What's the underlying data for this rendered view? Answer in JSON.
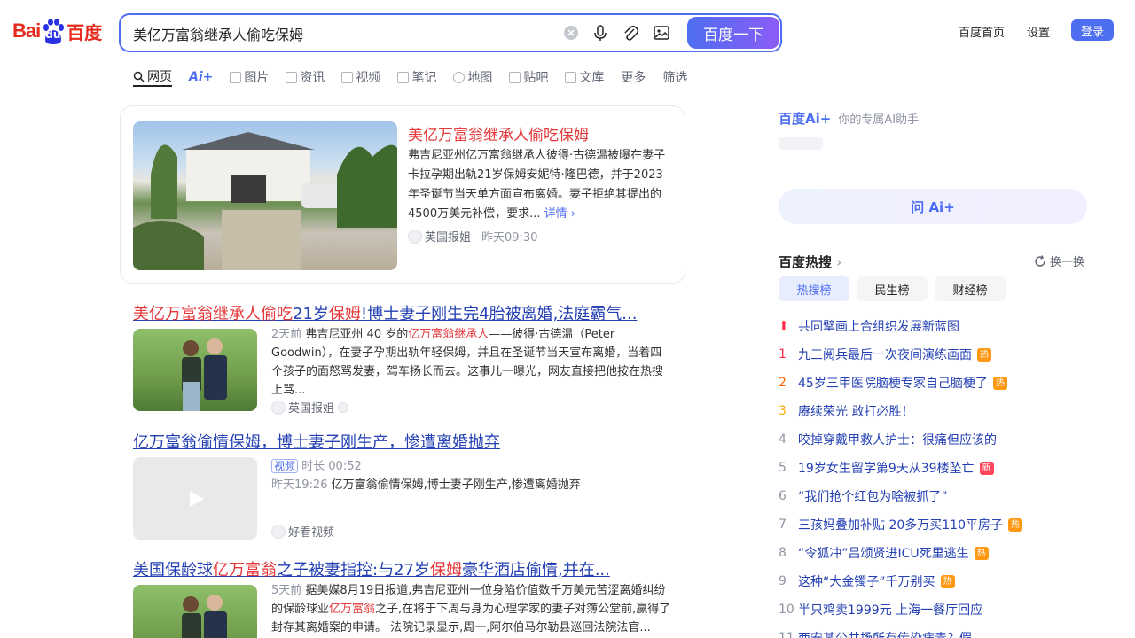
{
  "logo": {
    "left": "Bai",
    "paw": "du",
    "right": "百度"
  },
  "search": {
    "query": "美亿万富翁继承人偷吃保姆",
    "button": "百度一下"
  },
  "top_links": {
    "home": "百度首页",
    "settings": "设置",
    "login": "登录"
  },
  "tabs": [
    "网页",
    "Ai+",
    "图片",
    "资讯",
    "视频",
    "笔记",
    "地图",
    "贴吧",
    "文库",
    "更多",
    "筛选"
  ],
  "card": {
    "title": "美亿万富翁继承人偷吃保姆",
    "desc": "弗吉尼亚州亿万富翁继承人彼得·古德温被曝在妻子卡拉孕期出轨21岁保姆安妮特·隆巴德，并于2023年圣诞节当天单方面宣布离婚。妻子拒绝其提出的4500万美元补偿，要求...",
    "more": "详情 ›",
    "source": "英国报姐",
    "time": "昨天09:30"
  },
  "results": [
    {
      "title_parts": [
        [
          "美亿万富翁继承人偷吃",
          true
        ],
        [
          "21岁",
          false
        ],
        [
          "保姆",
          true
        ],
        [
          "!博士妻子刚生完4胎被离婚,法庭霸气...",
          false
        ]
      ],
      "time": "2天前",
      "desc_a": "弗吉尼亚州 40 岁的",
      "desc_hl": "亿万富翁继承人",
      "desc_b": "——彼得·古德温（Peter Goodwin），在妻子孕期出轨年轻保姆，并且在圣诞节当天宣布离婚，当着四个孩子的面怒骂发妻，驾车扬长而去。这事儿一曝光，网友直接把他按在热搜上骂...",
      "source": "英国报姐"
    },
    {
      "title": "亿万富翁偷情保姆，博士妻子刚生产，惨遭离婚抛弃",
      "tag": "视频",
      "duration": "时长 00:52",
      "time": "昨天19:26",
      "desc": "亿万富翁偷情保姆,博士妻子刚生产,惨遭离婚抛弃",
      "source": "好看视频"
    },
    {
      "title_a": "美国保龄球",
      "title_hl1": "亿万富翁",
      "title_b": "之子被妻指控:与27岁",
      "title_hl2": "保姆",
      "title_c": "豪华酒店偷情,并在...",
      "time": "5天前",
      "desc_a": "据美媒8月19日报道,弗吉尼亚州一位身陷价值数千万美元苦涩离婚纠纷的保龄球业",
      "desc_hl": "亿万富翁",
      "desc_b": "之子,在将于下周与身为心理学家的妻子对簿公堂前,赢得了封存其离婚案的申请。 法院记录显示,周一,阿尔伯马尔勒县巡回法院法官..."
    }
  ],
  "ai": {
    "logo": "百度Ai+",
    "subtitle": "你的专属AI助手",
    "ask": "问 Ai+"
  },
  "hot": {
    "title": "百度热搜",
    "refresh": "换一换",
    "tabs": [
      "热搜榜",
      "民生榜",
      "财经榜"
    ],
    "items": [
      {
        "rank": "⬆",
        "text": "共同擘画上合组织发展新蓝图",
        "badge": ""
      },
      {
        "rank": "1",
        "text": "九三阅兵最后一次夜间演练画面",
        "badge": "热"
      },
      {
        "rank": "2",
        "text": "45岁三甲医院脑梗专家自己脑梗了",
        "badge": "热"
      },
      {
        "rank": "3",
        "text": "赓续荣光 敢打必胜！",
        "badge": ""
      },
      {
        "rank": "4",
        "text": "咬掉穿戴甲救人护士：很痛但应该的",
        "badge": ""
      },
      {
        "rank": "5",
        "text": "19岁女生留学第9天从39楼坠亡",
        "badge": "新"
      },
      {
        "rank": "6",
        "text": "“我们抢个红包为啥被抓了”",
        "badge": ""
      },
      {
        "rank": "7",
        "text": "三孩妈叠加补贴 20多万买110平房子",
        "badge": "热"
      },
      {
        "rank": "8",
        "text": "“令狐冲”吕颂贤进ICU死里逃生",
        "badge": "热"
      },
      {
        "rank": "9",
        "text": "这种“大金镯子”千万别买",
        "badge": "热"
      },
      {
        "rank": "10",
        "text": "半只鸡卖1999元 上海一餐厅回应",
        "badge": ""
      },
      {
        "rank": "11",
        "text": "西安某公共场所有传染病毒？假",
        "badge": ""
      }
    ]
  }
}
